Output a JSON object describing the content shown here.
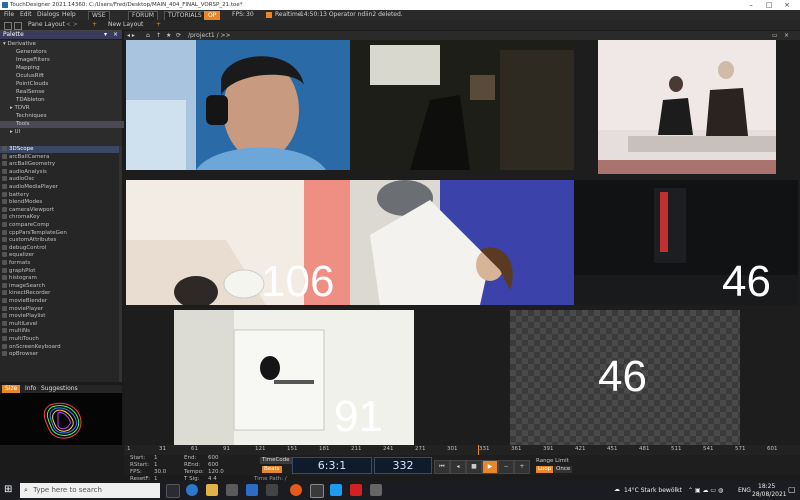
{
  "title_bar": {
    "text": "TouchDesigner 2021.14360: C:/Users/Fred/Desktop/MAIN_404_FINAL_VORSP_21.toe*"
  },
  "menu": {
    "file": "File",
    "edit": "Edit",
    "dialogs": "Dialogs",
    "help": "Help"
  },
  "toolbar": {
    "mode": "WSE",
    "forum": "FORUM",
    "tutorials": "TUTORIALS",
    "op": "OP",
    "fps_label": "FPS:",
    "fps": "30",
    "realtime": "Realtime",
    "status": "14:50:13 Operator ndiin2 deleted."
  },
  "panes": {
    "pane_layout": "Pane Layout",
    "new_layout": "New Layout"
  },
  "palette": {
    "title": "Palette",
    "tree": [
      "Derivative",
      "Generators",
      "ImageFilters",
      "Mapping",
      "OculusRift",
      "PointClouds",
      "RealSense",
      "TDAbleton",
      "TDVR",
      "Techniques",
      "Tools",
      "UI"
    ],
    "components": [
      "3DScope",
      "arcBallCamera",
      "arcBallGeometry",
      "audioAnalysis",
      "audioOsc",
      "audioMediaPlayer",
      "battery",
      "blendModes",
      "cameraViewport",
      "chromaKey",
      "compareComp",
      "cppParsTemplateGen",
      "customAttributes",
      "debugControl",
      "equalizer",
      "formats",
      "graphPlot",
      "histogram",
      "imageSearch",
      "kinectRecorder",
      "movieBlender",
      "moviePlayer",
      "moviePlaylist",
      "multiLevel",
      "multiNs",
      "multiTouch",
      "onScreenKeyboard",
      "opBrowser"
    ],
    "bottom_tabs": [
      "Size",
      "Info",
      "Suggestions"
    ]
  },
  "viewer": {
    "path": "/project1 / >>",
    "counts": {
      "tile4": "106",
      "tile6": "46",
      "tile7": "91",
      "tile8": "46"
    }
  },
  "timeline": {
    "ticks": [
      "1",
      "31",
      "61",
      "91",
      "121",
      "151",
      "181",
      "211",
      "241",
      "271",
      "301",
      "331",
      "361",
      "391",
      "421",
      "451",
      "481",
      "511",
      "541",
      "571",
      "601"
    ],
    "start": "1",
    "end": "600",
    "rstart": "1",
    "rend": "600",
    "fps": "30.0",
    "tempo": "120.0",
    "resetf": "1",
    "tsig": "4   4",
    "start_label": "Start:",
    "end_label": "End:",
    "rstart_label": "RStart:",
    "rend_label": "REnd:",
    "fps_label": "FPS:",
    "tempo_label": "Tempo:",
    "resetf_label": "ResetF:",
    "tsig_label": "T Sig:",
    "timecode_label": "TimeCode",
    "beats_label": "Beats",
    "timecode": "6:3:1",
    "frame": "332",
    "range_limit": "Range Limit",
    "loop": "Loop",
    "once": "Once",
    "time_path": "Time Path: /"
  },
  "taskbar": {
    "search_placeholder": "Type here to search",
    "weather": "14°C  Stark bewölkt",
    "lang": "ENG",
    "time": "18:25",
    "date": "28/08/2021"
  },
  "colors": {
    "accent_orange": "#e8872a",
    "blue_display": "#0f1a2a",
    "selected_blue": "#3c4766"
  }
}
